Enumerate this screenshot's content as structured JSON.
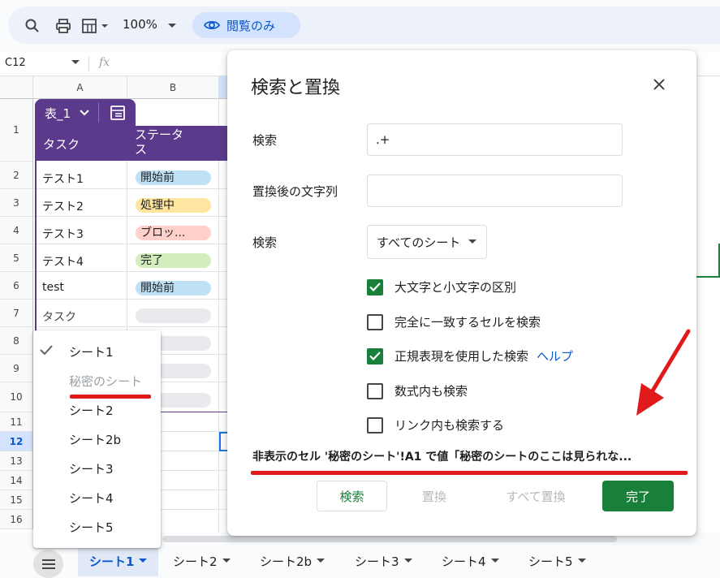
{
  "toolbar": {
    "zoom": "100%",
    "view_only_label": "閲覧のみ"
  },
  "formula_bar": {
    "cell_ref": "C12",
    "fx": "fx"
  },
  "grid": {
    "columns": [
      "A",
      "B"
    ],
    "rows": [
      "1",
      "2",
      "3",
      "4",
      "5",
      "6",
      "7",
      "8",
      "9",
      "10",
      "11",
      "12",
      "13",
      "14",
      "15",
      "16"
    ],
    "selected_row": "12"
  },
  "table": {
    "name": "表_1",
    "headers": [
      "タスク",
      "ステータ\nス"
    ],
    "rows": [
      {
        "task": "テスト1",
        "status": "開始前",
        "color": "#bfe1f6"
      },
      {
        "task": "テスト2",
        "status": "処理中",
        "color": "#ffe5a0"
      },
      {
        "task": "テスト3",
        "status": "ブロッ...",
        "color": "#ffcfc9"
      },
      {
        "task": "テスト4",
        "status": "完了",
        "color": "#d4edbc"
      },
      {
        "task": "test",
        "status": "開始前",
        "color": "#bfe1f6"
      },
      {
        "task": "タスク",
        "status": "",
        "color": "#e8eaed"
      }
    ]
  },
  "sheet_menu": {
    "items": [
      "シート1",
      "秘密のシート",
      "シート2",
      "シート2b",
      "シート3",
      "シート4",
      "シート5"
    ]
  },
  "sheet_tabs": [
    "シート1",
    "シート2",
    "シート2b",
    "シート3",
    "シート4",
    "シート5"
  ],
  "dialog": {
    "title": "検索と置換",
    "find_label": "検索",
    "find_value": ".+",
    "replace_label": "置換後の文字列",
    "replace_value": "",
    "scope_label": "検索",
    "scope_value": "すべてのシート",
    "options": [
      {
        "label": "大文字と小文字の区別",
        "checked": true
      },
      {
        "label": "完全に一致するセルを検索",
        "checked": false
      },
      {
        "label": "正規表現を使用した検索",
        "checked": true,
        "link": "ヘルプ"
      },
      {
        "label": "数式内も検索",
        "checked": false
      },
      {
        "label": "リンク内も検索する",
        "checked": false
      }
    ],
    "result_message": "非表示のセル '秘密のシート'!A1 で値「秘密のシートのここは見られな...",
    "buttons": {
      "find": "検索",
      "replace": "置換",
      "replace_all": "すべて置換",
      "done": "完了"
    }
  },
  "colors": {
    "accent_green": "#188038",
    "table_header": "#5b3a8c",
    "annotation_red": "#e0191a",
    "selected_blue": "#d3e3fd"
  }
}
